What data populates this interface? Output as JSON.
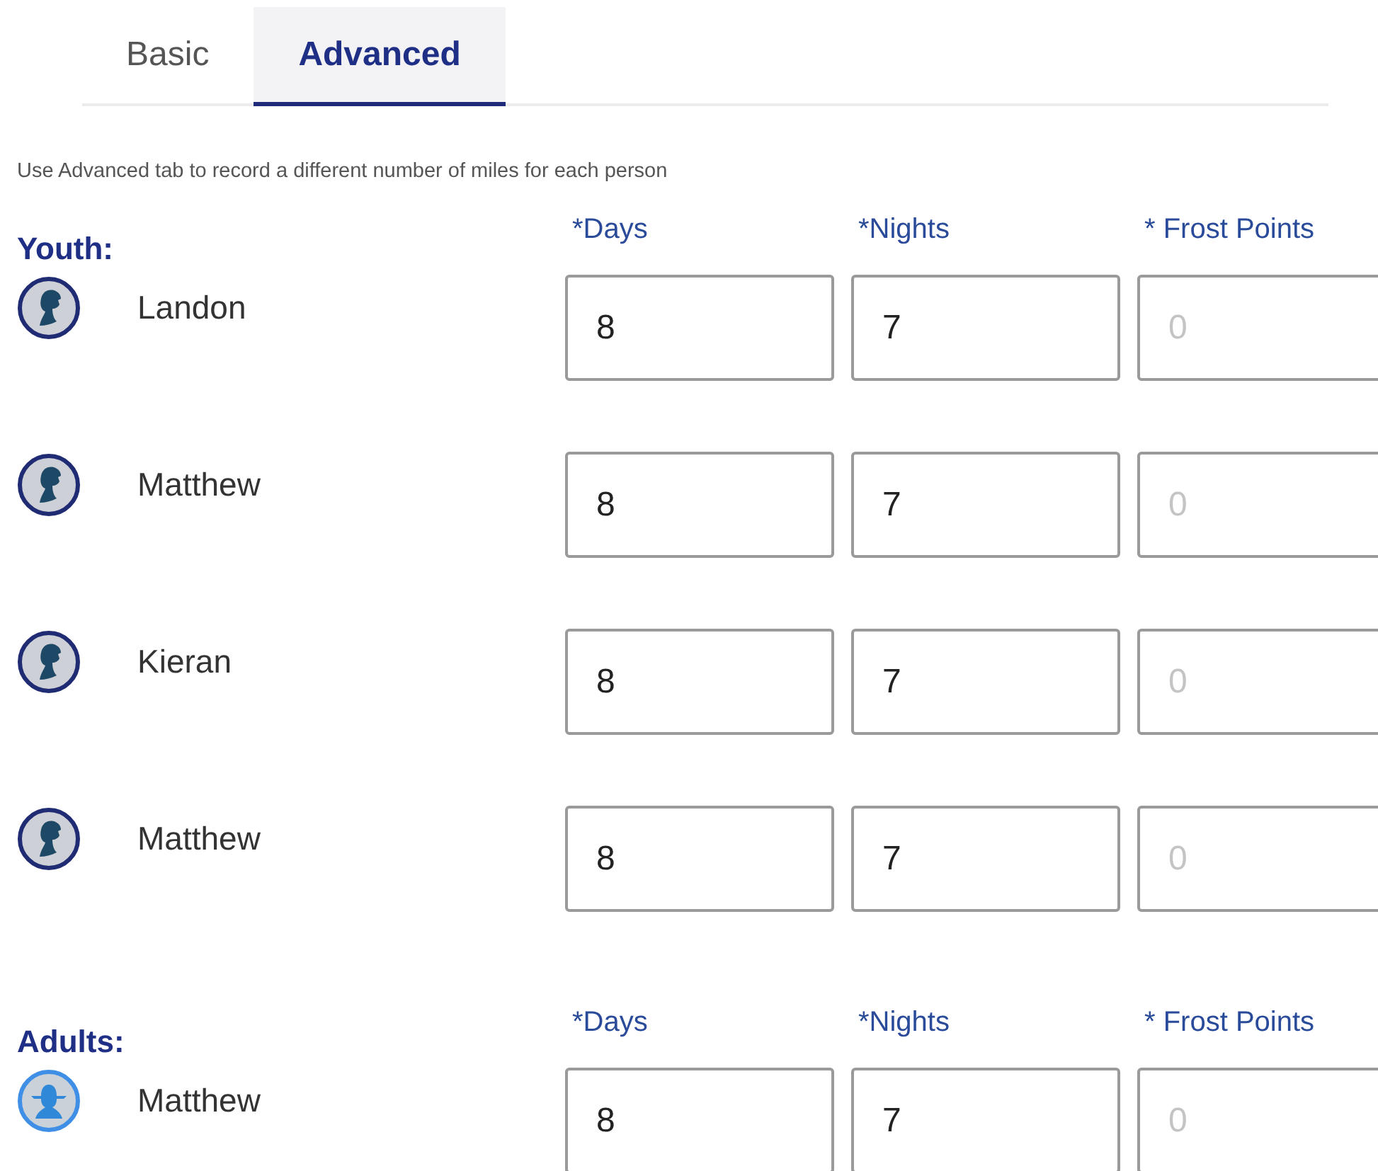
{
  "tabs": [
    {
      "label": "Basic",
      "selected": false
    },
    {
      "label": "Advanced",
      "selected": true
    }
  ],
  "note": "Use Advanced tab to record a different number of miles for each person",
  "groups": [
    {
      "heading": "Youth:",
      "kind": "youth",
      "columns": [
        "*Days",
        "*Nights",
        "* Frost Points"
      ],
      "people": [
        {
          "name": "Landon",
          "days": "8",
          "nights": "7",
          "frost_placeholder": "0"
        },
        {
          "name": "Matthew",
          "days": "8",
          "nights": "7",
          "frost_placeholder": "0"
        },
        {
          "name": "Kieran",
          "days": "8",
          "nights": "7",
          "frost_placeholder": "0"
        },
        {
          "name": "Matthew",
          "days": "8",
          "nights": "7",
          "frost_placeholder": "0"
        }
      ]
    },
    {
      "heading": "Adults:",
      "kind": "adult",
      "columns": [
        "*Days",
        "*Nights",
        "* Frost Points"
      ],
      "people": [
        {
          "name": "Matthew",
          "days": "8",
          "nights": "7",
          "frost_placeholder": "0"
        }
      ]
    }
  ]
}
